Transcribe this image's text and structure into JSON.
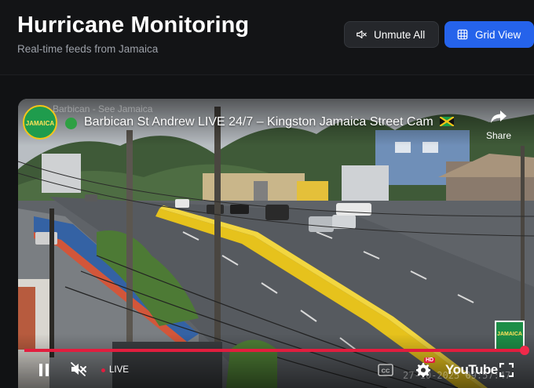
{
  "header": {
    "title": "Hurricane Monitoring",
    "subtitle": "Real-time feeds from Jamaica",
    "unmute_label": "Unmute All",
    "grid_label": "Grid View"
  },
  "player": {
    "channel_logo_text": "JAMAICA",
    "channel_ghost_text": "Barbican - See Jamaica",
    "video_title": "Barbican St Andrew LIVE 24/7 – Kingston Jamaica Street Cam",
    "share_label": "Share",
    "live_label": "LIVE",
    "hd_badge": "HD",
    "youtube_label": "YouTube",
    "timestamp": "27-10-2025 09:57:47",
    "progress_percent": 100,
    "thumbnail_logo_text": "JAMAICA"
  },
  "icons": {
    "unmute": "speaker-muted-icon",
    "grid": "grid-icon",
    "share": "share-arrow-icon",
    "pause": "pause-icon",
    "mute": "speaker-muted-icon",
    "captions": "cc-icon",
    "settings": "gear-icon",
    "fullscreen": "fullscreen-icon"
  },
  "colors": {
    "accent": "#2563eb",
    "progress": "#e21d3e",
    "live_dot": "#2ea043",
    "background": "#111214"
  }
}
